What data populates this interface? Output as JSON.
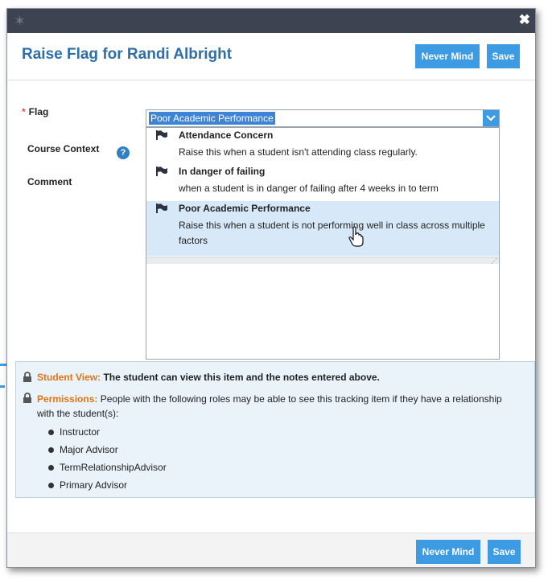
{
  "dialog": {
    "title": "Raise Flag for Randi Albright",
    "never_mind_label": "Never Mind",
    "save_label": "Save"
  },
  "form": {
    "flag_label": "Flag",
    "required_mark": "*",
    "course_context_label": "Course Context",
    "comment_label": "Comment",
    "flag_selected": "Poor Academic Performance"
  },
  "dropdown": {
    "options": [
      {
        "title": "Attendance Concern",
        "description": "Raise this when a student isn't attending class regularly."
      },
      {
        "title": "In danger of failing",
        "description": "when a student is in danger of failing after 4 weeks in to term"
      },
      {
        "title": "Poor Academic Performance",
        "description": "Raise this when a student is not performing well in class across multiple factors"
      }
    ],
    "selected_index": 2
  },
  "info": {
    "student_view_label": "Student View:",
    "student_view_text": "The student can view this item and the notes entered above.",
    "permissions_label": "Permissions:",
    "permissions_text": "People with the following roles may be able to see this tracking item if they have a relationship with the student(s):",
    "roles": [
      "Instructor",
      "Major Advisor",
      "TermRelationshipAdvisor",
      "Primary Advisor"
    ]
  },
  "colors": {
    "title_blue": "#2f6fa6",
    "button_blue": "#3d9be4",
    "titlebar": "#3d4350",
    "orange": "#e07410",
    "selected_row": "#d7e9f8"
  },
  "icons": [
    "star-icon",
    "close-icon",
    "help-icon",
    "chevron-down-icon",
    "flag-icon",
    "lock-icon",
    "hand-cursor-icon"
  ]
}
